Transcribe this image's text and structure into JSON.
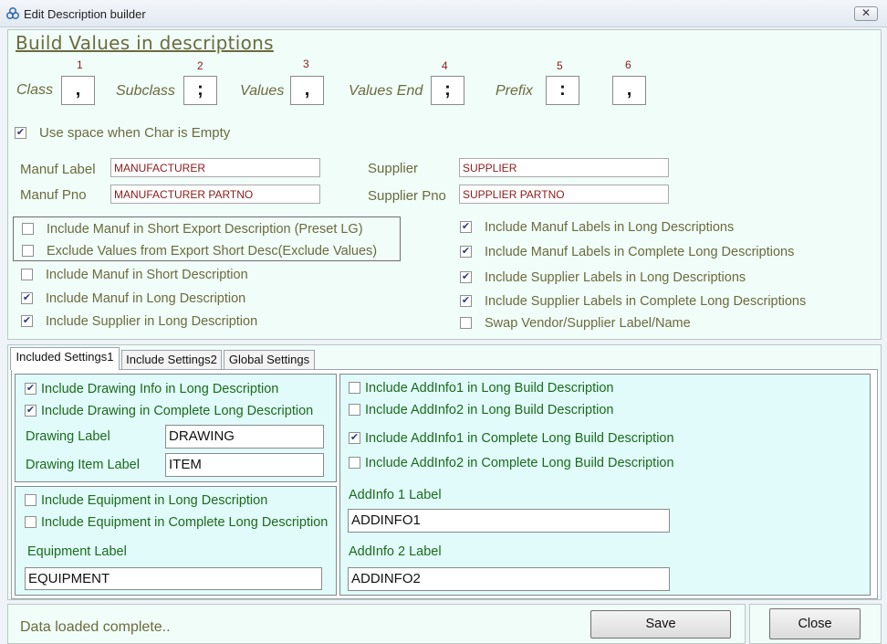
{
  "window": {
    "title": "Edit Description builder",
    "close_glyph": "✕"
  },
  "heading": "Build Values in descriptions",
  "separators": [
    {
      "num": "1",
      "label": "Class",
      "value": ","
    },
    {
      "num": "2",
      "label": "Subclass",
      "value": ";"
    },
    {
      "num": "3",
      "label": "Values",
      "value": ","
    },
    {
      "num": "4",
      "label": "Values End",
      "value": ";"
    },
    {
      "num": "5",
      "label": "Prefix",
      "value": ":"
    },
    {
      "num": "6",
      "label": "",
      "value": ","
    }
  ],
  "use_space": {
    "label": "Use space when Char is Empty",
    "checked": true
  },
  "labels": {
    "manuf_label": "Manuf Label",
    "manuf_label_value": "MANUFACTURER",
    "manuf_pno": "Manuf Pno",
    "manuf_pno_value": "MANUFACTURER PARTNO",
    "supplier": "Supplier",
    "supplier_value": "SUPPLIER",
    "supplier_pno": "Supplier Pno",
    "supplier_pno_value": "SUPPLIER PARTNO"
  },
  "left_checks": [
    {
      "label": "Include Manuf in Short Export Description (Preset LG)",
      "checked": false
    },
    {
      "label": "Exclude Values from Export Short Desc(Exclude Values)",
      "checked": false
    },
    {
      "label": "Include Manuf in Short Description",
      "checked": false
    },
    {
      "label": "Include Manuf in Long Description",
      "checked": true
    },
    {
      "label": "Include Supplier in Long Description",
      "checked": true
    }
  ],
  "right_checks": [
    {
      "label": "Include Manuf Labels in Long Descriptions",
      "checked": true
    },
    {
      "label": "Include Manuf Labels in Complete Long Descriptions",
      "checked": true
    },
    {
      "label": "Include Supplier Labels in Long Descriptions",
      "checked": true
    },
    {
      "label": "Include Supplier Labels in Complete Long Descriptions",
      "checked": true
    },
    {
      "label": "Swap Vendor/Supplier Label/Name",
      "checked": false
    }
  ],
  "tabs": [
    {
      "label": "Included Settings1",
      "active": true
    },
    {
      "label": "Include Settings2",
      "active": false
    },
    {
      "label": "Global Settings",
      "active": false
    }
  ],
  "drawing": {
    "checks": [
      {
        "label": "Include Drawing Info in Long Description",
        "checked": true
      },
      {
        "label": "Include Drawing in Complete Long Description",
        "checked": true
      }
    ],
    "label_caption": "Drawing Label",
    "label_value": "DRAWING",
    "item_caption": "Drawing Item Label",
    "item_value": "ITEM"
  },
  "equipment": {
    "checks": [
      {
        "label": "Include Equipment in Long Description",
        "checked": false
      },
      {
        "label": "Include Equipment in Complete Long Description",
        "checked": false
      }
    ],
    "label_caption": "Equipment Label",
    "label_value": "EQUIPMENT"
  },
  "addinfo": {
    "checks": [
      {
        "label": "Include AddInfo1 in Long Build Description",
        "checked": false
      },
      {
        "label": "Include AddInfo2 in Long Build Description",
        "checked": false
      },
      {
        "label": "Include AddInfo1 in Complete Long Build Description",
        "checked": true
      },
      {
        "label": "Include AddInfo2 in Complete Long Build Description",
        "checked": false
      }
    ],
    "label1_caption": "AddInfo 1 Label",
    "label1_value": "ADDINFO1",
    "label2_caption": "AddInfo 2 Label",
    "label2_value": "ADDINFO2"
  },
  "status": "Data loaded complete..",
  "buttons": {
    "save": "Save",
    "close": "Close"
  },
  "check_glyph": "✔"
}
